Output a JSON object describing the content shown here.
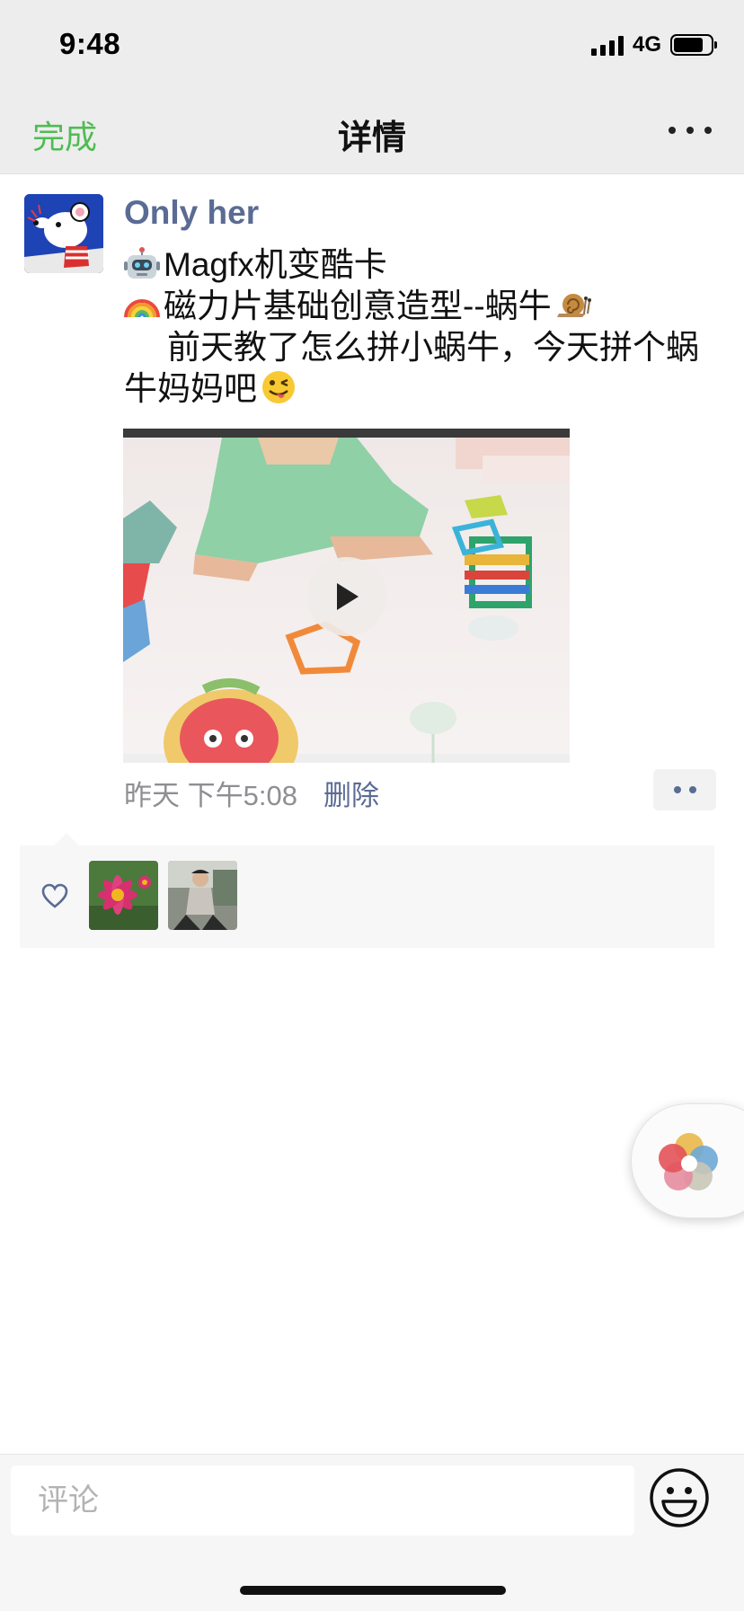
{
  "status_bar": {
    "time": "9:48",
    "network": "4G",
    "battery_level": 0.8
  },
  "nav": {
    "done_label": "完成",
    "title": "详情"
  },
  "post": {
    "author": "Only her",
    "lines": [
      "Magfx机变酷卡",
      "磁力片基础创意造型--蜗牛",
      "前天教了怎么拼小蜗牛，今天拼个蜗牛妈妈吧"
    ],
    "emoji_icons": [
      "robot-emoji",
      "rainbow-emoji",
      "snail-emoji",
      "winking-tongue-emoji"
    ],
    "time": "昨天 下午5:08",
    "delete_label": "删除"
  },
  "comment": {
    "placeholder": "评论"
  },
  "colors": {
    "accent_green": "#4fbc53",
    "link_blue": "#5a6b94",
    "topbar_bg": "#ededed",
    "likes_bg": "#f7f7f7"
  }
}
